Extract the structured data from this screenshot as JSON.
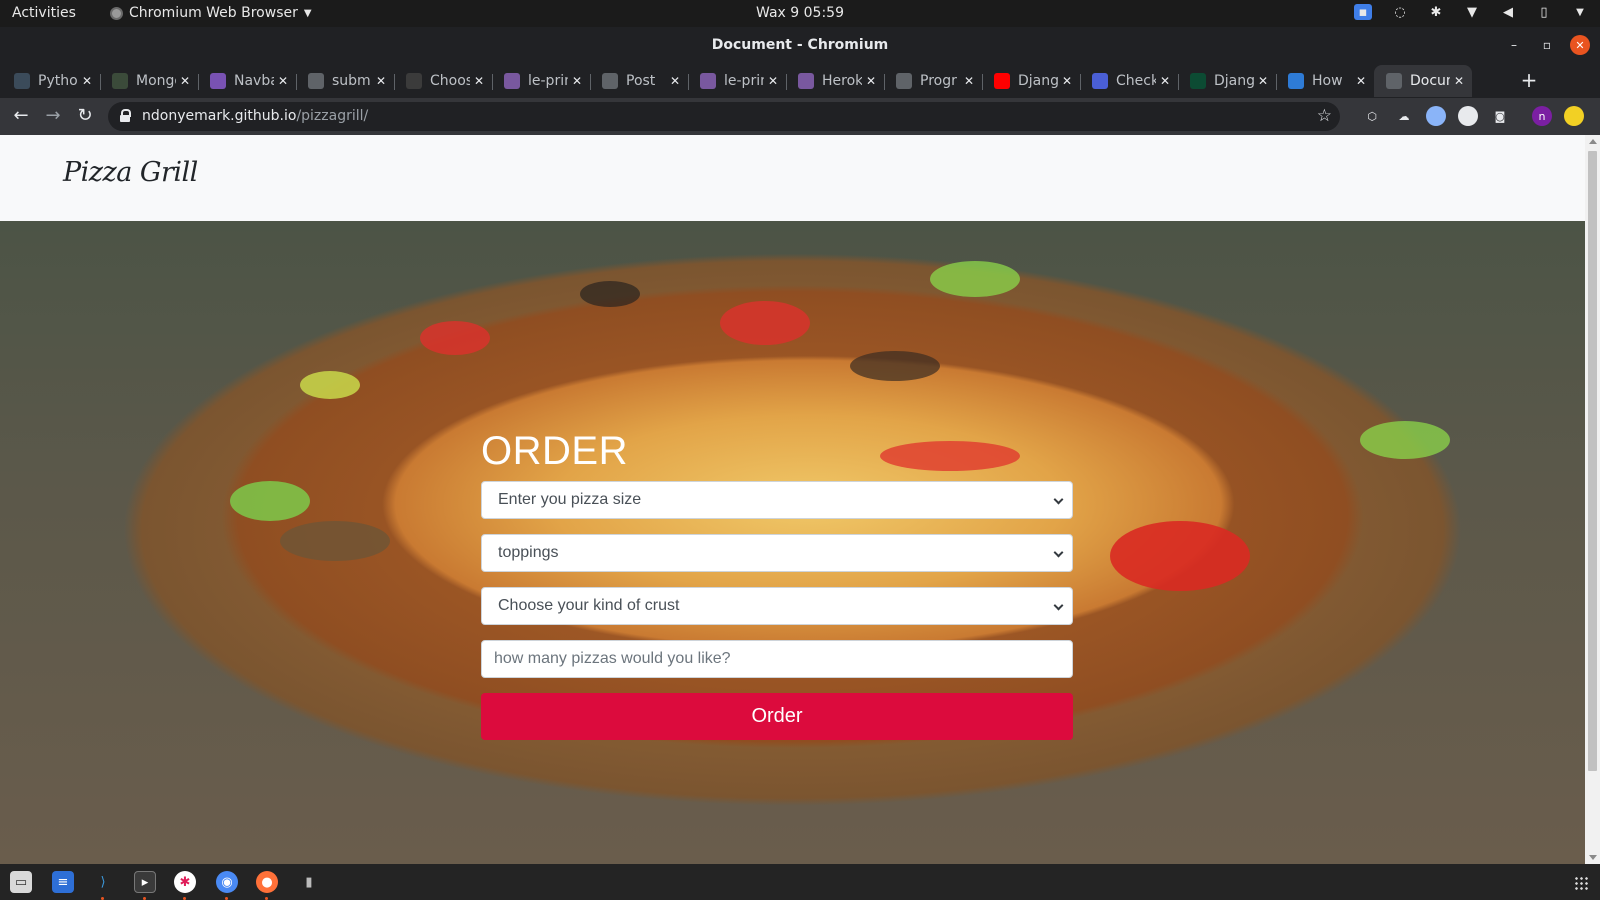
{
  "system": {
    "activities": "Activities",
    "app_menu": "Chromium Web Browser",
    "clock": "Wax 9  05:59"
  },
  "window": {
    "title": "Document - Chromium"
  },
  "tabs": [
    {
      "label": "Python",
      "icon": "python-favicon",
      "color": "#3b4b5a"
    },
    {
      "label": "Mongo",
      "icon": "mongo-favicon",
      "color": "#3b4b3a"
    },
    {
      "label": "Navbar",
      "icon": "bootstrap-favicon",
      "color": "#7952b3"
    },
    {
      "label": "submit",
      "icon": "globe-favicon",
      "color": "#5f6368"
    },
    {
      "label": "Choose",
      "icon": "w3schools-favicon",
      "color": "#3b3b3b"
    },
    {
      "label": "le-print",
      "icon": "heroku-favicon",
      "color": "#79589f"
    },
    {
      "label": "Post",
      "icon": "globe-favicon",
      "color": "#5f6368"
    },
    {
      "label": "le-print",
      "icon": "heroku-favicon",
      "color": "#79589f"
    },
    {
      "label": "Heroku",
      "icon": "heroku-favicon",
      "color": "#79589f"
    },
    {
      "label": "Progr",
      "icon": "globe-favicon",
      "color": "#5f6368"
    },
    {
      "label": "Django",
      "icon": "youtube-favicon",
      "color": "#ff0000"
    },
    {
      "label": "Check",
      "icon": "flag-favicon",
      "color": "#4a5fd6"
    },
    {
      "label": "Django",
      "icon": "django-favicon",
      "color": "#0c4b33"
    },
    {
      "label": "How",
      "icon": "stackoverflow-favicon",
      "color": "#2e7bd6"
    },
    {
      "label": "Document",
      "icon": "globe-favicon",
      "color": "#5f6368",
      "active": true
    }
  ],
  "address_bar": {
    "domain": "ndonyemark.github.io",
    "path": "/pizzagrill/"
  },
  "page": {
    "logo": "Pizza Grill",
    "order_title": "ORDER",
    "size_select": "Enter you pizza size",
    "toppings_select": "toppings",
    "crust_select": "Choose your kind of crust",
    "quantity_placeholder": "how many pizzas would you like?",
    "order_button": "Order"
  },
  "colors": {
    "order_button": "#dc0b3d",
    "nav_background": "#f8f9fa"
  }
}
